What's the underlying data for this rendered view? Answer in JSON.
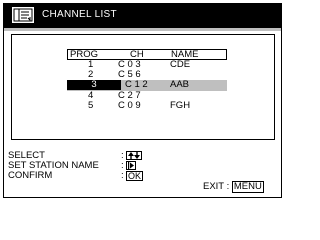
{
  "header": {
    "title": "CHANNEL LIST"
  },
  "table": {
    "columns": {
      "prog": "PROG",
      "ch": "CH",
      "name": "NAME"
    },
    "rows": [
      {
        "prog": "1",
        "ch": "C 0 3",
        "name": "CDE",
        "selected": false
      },
      {
        "prog": "2",
        "ch": "C 5 6",
        "name": "",
        "selected": false
      },
      {
        "prog": "3",
        "ch": "C 1 2",
        "name": "AAB",
        "selected": true
      },
      {
        "prog": "4",
        "ch": "C 2 7",
        "name": "",
        "selected": false
      },
      {
        "prog": "5",
        "ch": "C 0 9",
        "name": "FGH",
        "selected": false
      }
    ]
  },
  "footer": {
    "select_label": "SELECT",
    "set_station_label": "SET STATION NAME",
    "confirm_label": "CONFIRM",
    "ok_key": "OK",
    "exit_label": "EXIT",
    "menu_key": "MENU"
  },
  "colors": {
    "title_bar": "#000000",
    "highlight": "#bfbfbf",
    "background": "#ffffff"
  }
}
